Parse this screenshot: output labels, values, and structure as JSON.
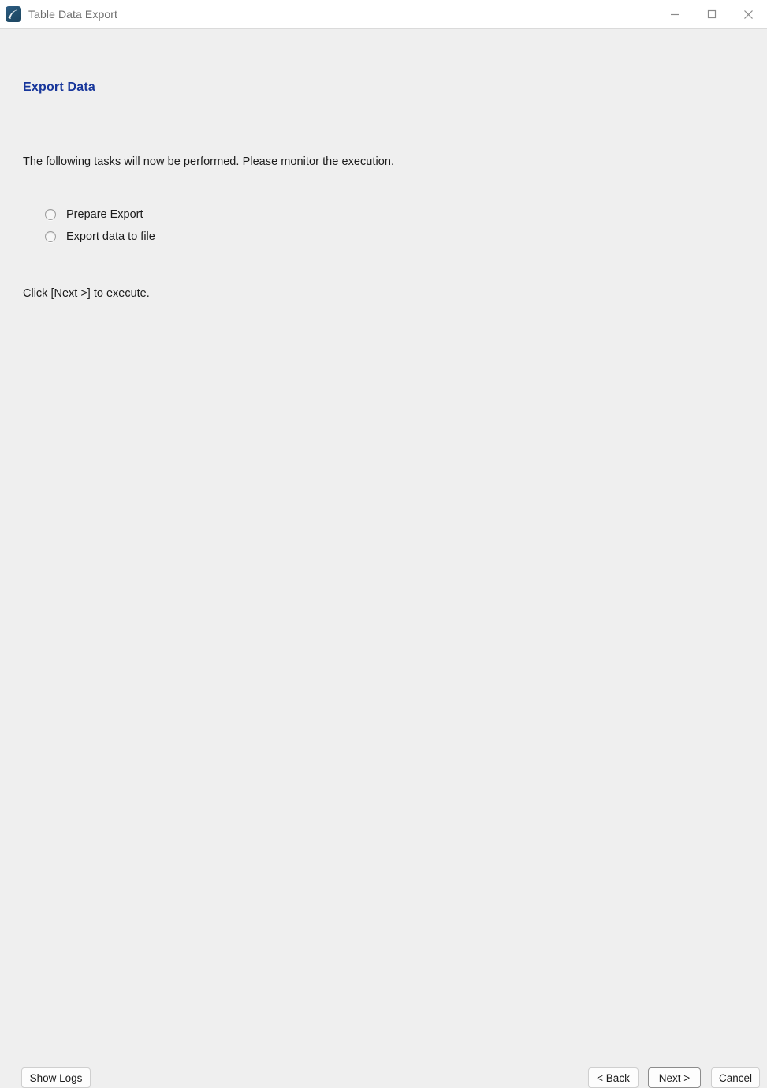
{
  "window": {
    "title": "Table Data Export",
    "app_icon": "mysql-dolphin-icon",
    "controls": {
      "minimize": "minimize-icon",
      "maximize": "maximize-icon",
      "close": "close-icon"
    }
  },
  "page": {
    "heading": "Export Data",
    "heading_color": "#17369b",
    "intro": "The following tasks will now be performed. Please monitor the execution.",
    "hint": "Click [Next >] to execute."
  },
  "tasks": [
    {
      "label": "Prepare Export",
      "status": "pending"
    },
    {
      "label": "Export data to file",
      "status": "pending"
    }
  ],
  "footer": {
    "show_logs": "Show Logs",
    "back": "< Back",
    "next": "Next >",
    "cancel": "Cancel"
  }
}
